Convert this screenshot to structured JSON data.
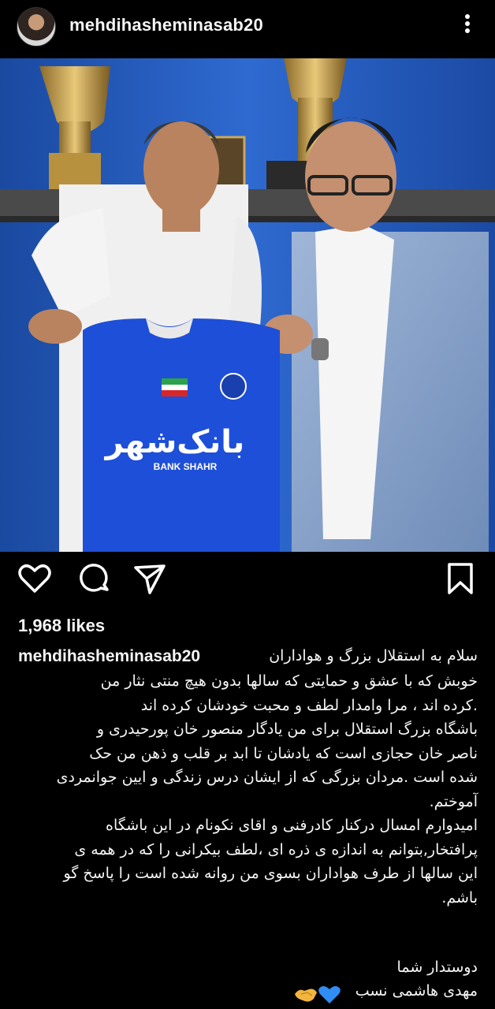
{
  "header": {
    "username": "mehdihasheminasab20",
    "avatar_icon": "profile-avatar",
    "more_icon": "more-options-icon"
  },
  "photo": {
    "jersey_sponsor": "بانک‌شهر",
    "jersey_sponsor_latin": "BANK SHAHR"
  },
  "actions": {
    "icons": [
      "heart-icon",
      "comment-icon",
      "share-icon",
      "bookmark-icon"
    ]
  },
  "likes": {
    "text": "1,968 likes"
  },
  "caption": {
    "username": "mehdihasheminasab20",
    "first_line": "سلام به استقلال بزرگ و هواداران",
    "body": "خوبش که با عشق و حمایتی  که سالها بدون هیچ منتی نثار من\n.کرده اند ، مرا وامدار لطف و محبت خودشان کرده اند\nباشگاه بزرگ استقلال برای من یادگار منصور خان پورحیدری و\nناصر خان حجازی است که یادشان تا ابد بر قلب و ذهن من حک\nشده است .مردان بزرگی که از ایشان  درس زندگی و ایین جوانمردی\nآموختم.\nامیدوارم امسال درکنار کادرفنی و اقای نکونام در این باشگاه\nپرافتخار,بتوانم به اندازه ی ذره ای ،لطف بیکرانی را که در همه ی\nاین سالها از طرف هواداران بسوی من روانه شده است را  پاسخ گو\nباشم.",
    "signoff": "دوستدار شما\nمهدی هاشمی نسب",
    "emoji_icons": [
      "blue-heart-icon",
      "handshake-icon"
    ]
  }
}
